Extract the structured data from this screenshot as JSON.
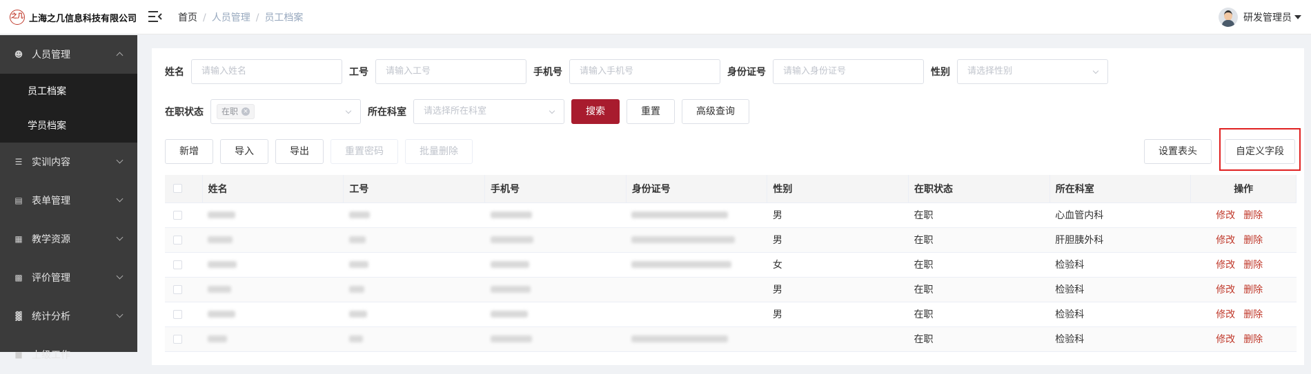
{
  "app": {
    "company": "上海之几信息科技有限公司",
    "logo_mark": "之几"
  },
  "breadcrumb": {
    "home": "首页",
    "sep": "/",
    "level1": "人员管理",
    "level2": "员工档案"
  },
  "user": {
    "name": "研发管理员"
  },
  "sidebar": {
    "groups": [
      {
        "label": "人员管理",
        "icon": "user-group-icon",
        "open": true,
        "children": [
          {
            "label": "员工档案",
            "active": true
          },
          {
            "label": "学员档案",
            "active": false
          }
        ]
      },
      {
        "label": "实训内容",
        "icon": "book-icon"
      },
      {
        "label": "表单管理",
        "icon": "form-icon"
      },
      {
        "label": "教学资源",
        "icon": "resource-icon"
      },
      {
        "label": "评价管理",
        "icon": "evaluation-icon"
      },
      {
        "label": "统计分析",
        "icon": "bar-chart-icon"
      },
      {
        "label": "上级工作",
        "icon": "work-icon"
      }
    ]
  },
  "filters": {
    "name": {
      "label": "姓名",
      "placeholder": "请输入姓名"
    },
    "emp_no": {
      "label": "工号",
      "placeholder": "请输入工号"
    },
    "phone": {
      "label": "手机号",
      "placeholder": "请输入手机号"
    },
    "id_no": {
      "label": "身份证号",
      "placeholder": "请输入身份证号"
    },
    "gender": {
      "label": "性别",
      "placeholder": "请选择性别"
    },
    "status": {
      "label": "在职状态",
      "value": "在职"
    },
    "dept": {
      "label": "所在科室",
      "placeholder": "请选择所在科室"
    },
    "search_label": "搜索",
    "reset_label": "重置",
    "advanced_label": "高级查询"
  },
  "toolbar": {
    "add": "新增",
    "import": "导入",
    "export": "导出",
    "reset_pwd": "重置密码",
    "batch_delete": "批量删除",
    "set_header": "设置表头",
    "custom_field": "自定义字段"
  },
  "table": {
    "columns": [
      "姓名",
      "工号",
      "手机号",
      "身份证号",
      "性别",
      "在职状态",
      "所在科室",
      "操作"
    ],
    "rows": [
      {
        "gender": "男",
        "status": "在职",
        "dept": "心血管内科"
      },
      {
        "gender": "男",
        "status": "在职",
        "dept": "肝胆胰外科"
      },
      {
        "gender": "女",
        "status": "在职",
        "dept": "检验科"
      },
      {
        "gender": "男",
        "status": "在职",
        "dept": "检验科"
      },
      {
        "gender": "男",
        "status": "在职",
        "dept": "检验科"
      },
      {
        "gender": "",
        "status": "在职",
        "dept": "检验科"
      }
    ],
    "edit_label": "修改",
    "delete_label": "删除"
  },
  "colors": {
    "primary": "#a81c2e",
    "sidebar": "#3b3b3b",
    "highlight": "#e02020"
  }
}
